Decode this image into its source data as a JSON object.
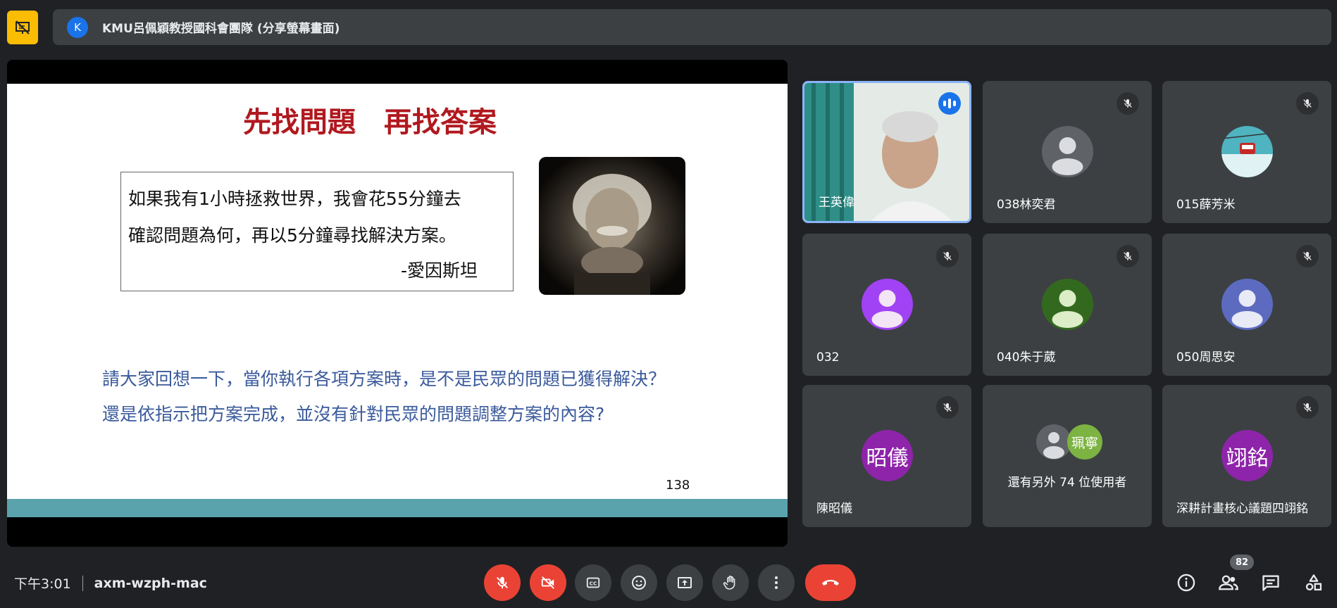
{
  "colors": {
    "background": "#202124",
    "surface": "#3c4043",
    "accent_yellow": "#fbbc04",
    "danger": "#ea4335",
    "speaking_blue": "#1a73e8",
    "slide_title_red": "#b0191f",
    "slide_question_blue": "#3a5a9c",
    "slide_bar_teal": "#5aa3ad"
  },
  "header": {
    "presenter_initial": "K",
    "presenter_label": "KMU呂佩穎教授國科會團隊 (分享螢幕畫面)"
  },
  "slide": {
    "title": "先找問題　再找答案",
    "quote_lines": [
      "如果我有1小時拯救世界，我會花55分鐘去",
      "確認問題為何，再以5分鐘尋找解決方案。"
    ],
    "quote_author": "-愛因斯坦",
    "question_lines": [
      "請大家回想一下，當你執行各項方案時，是不是民眾的問題已獲得解決？",
      "還是依指示把方案完成，並沒有針對民眾的問題調整方案的內容?"
    ],
    "page_number": "138"
  },
  "participants": [
    {
      "name": "王英偉",
      "state": "speaking",
      "avatar": "video"
    },
    {
      "name": "038林奕君",
      "state": "muted",
      "avatar": "default",
      "avatar_color": "#5f6368"
    },
    {
      "name": "015薛芳米",
      "state": "muted",
      "avatar": "photo",
      "avatar_color": "#4fb3c0"
    },
    {
      "name": "032",
      "state": "muted",
      "avatar": "default",
      "avatar_color": "#a142f4"
    },
    {
      "name": "040朱于葳",
      "state": "muted",
      "avatar": "default",
      "avatar_color": "#33691e"
    },
    {
      "name": "050周思安",
      "state": "muted",
      "avatar": "default",
      "avatar_color": "#5c6bc0"
    },
    {
      "name": "陳昭儀",
      "state": "muted",
      "avatar": "initials",
      "avatar_text": "昭儀",
      "avatar_color": "#8e24aa"
    },
    {
      "name": "深耕計畫核心議題四翊銘",
      "state": "muted",
      "avatar": "initials",
      "avatar_text": "翊銘",
      "avatar_color": "#8e24aa"
    }
  ],
  "others_tile": {
    "avatar_text": "珮寧",
    "avatar_color": "#7cb342",
    "label": "還有另外 74 位使用者"
  },
  "footer": {
    "time": "下午3:01",
    "meeting_code": "axm-wzph-mac",
    "people_count": "82"
  }
}
